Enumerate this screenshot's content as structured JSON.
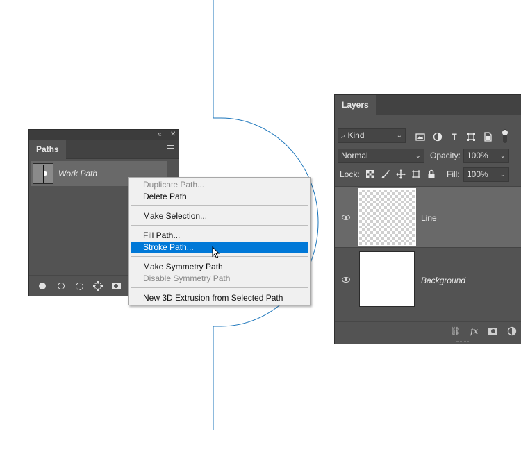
{
  "paths_panel": {
    "tab_label": "Paths",
    "items": [
      {
        "name": "Work Path"
      }
    ],
    "footer_icons": [
      "fill-path-icon",
      "stroke-path-icon",
      "load-selection-icon",
      "make-work-path-icon",
      "add-mask-icon"
    ]
  },
  "context_menu": {
    "items": [
      {
        "label": "Duplicate Path...",
        "enabled": false
      },
      {
        "label": "Delete Path",
        "enabled": true
      },
      {
        "label": "Make Selection...",
        "enabled": true
      },
      {
        "label": "Fill Path...",
        "enabled": true
      },
      {
        "label": "Stroke Path...",
        "enabled": true,
        "highlighted": true
      },
      {
        "label": "Make Symmetry Path",
        "enabled": true
      },
      {
        "label": "Disable Symmetry Path",
        "enabled": false
      },
      {
        "label": "New 3D Extrusion from Selected Path",
        "enabled": true
      }
    ]
  },
  "layers_panel": {
    "tab_label": "Layers",
    "filter_kind": "Kind",
    "blend_mode": "Normal",
    "opacity_label": "Opacity:",
    "opacity_value": "100%",
    "lock_label": "Lock:",
    "fill_label": "Fill:",
    "fill_value": "100%",
    "layers": [
      {
        "name": "Line",
        "visible": true,
        "thumbnail": "transparent"
      },
      {
        "name": "Background",
        "visible": true,
        "thumbnail": "white",
        "italic": true
      }
    ],
    "footer_icons": [
      "link-icon",
      "fx-icon",
      "add-mask-icon",
      "adjustment-icon"
    ]
  },
  "colors": {
    "panel_bg": "#535353",
    "menu_highlight": "#0078d7",
    "path_stroke": "#1b75bb"
  }
}
